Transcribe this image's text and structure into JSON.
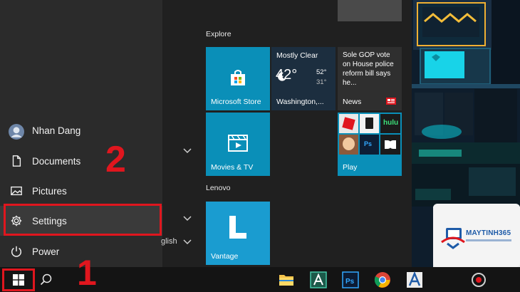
{
  "start_menu": {
    "rail": {
      "user": "Nhan Dang",
      "documents": "Documents",
      "pictures": "Pictures",
      "settings": "Settings",
      "power": "Power"
    },
    "app_list_partial": "glish",
    "groups": {
      "explore": "Explore",
      "lenovo": "Lenovo"
    },
    "tiles": {
      "microsoft_store": "Microsoft Store",
      "weather": {
        "condition": "Mostly Clear",
        "temperature": "42°",
        "high": "52°",
        "low": "31°",
        "location": "Washington,..."
      },
      "news": {
        "headline": "Sole GOP vote on House police reform bill says he...",
        "label": "News"
      },
      "movies_tv": "Movies & TV",
      "play": {
        "label": "Play",
        "apps": [
          "roblox",
          "solitaire",
          "hulu",
          "game",
          "photoshop-express",
          "dolby"
        ]
      },
      "vantage": "Vantage"
    }
  },
  "annotations": {
    "step_1": "1",
    "step_2": "2"
  },
  "watermark": {
    "brand": "MAYTINH365"
  },
  "colors": {
    "accent_tile": "#0a8fb8",
    "highlight": "#e0161e",
    "rail_bg": "#2b2b2b",
    "tiles_bg": "#202020",
    "taskbar_bg": "#141414"
  },
  "taskbar": {
    "icons": [
      "windows-logo",
      "search",
      "file-explorer",
      "app-a",
      "photoshop",
      "chrome",
      "app-a2",
      "app-extra"
    ]
  }
}
